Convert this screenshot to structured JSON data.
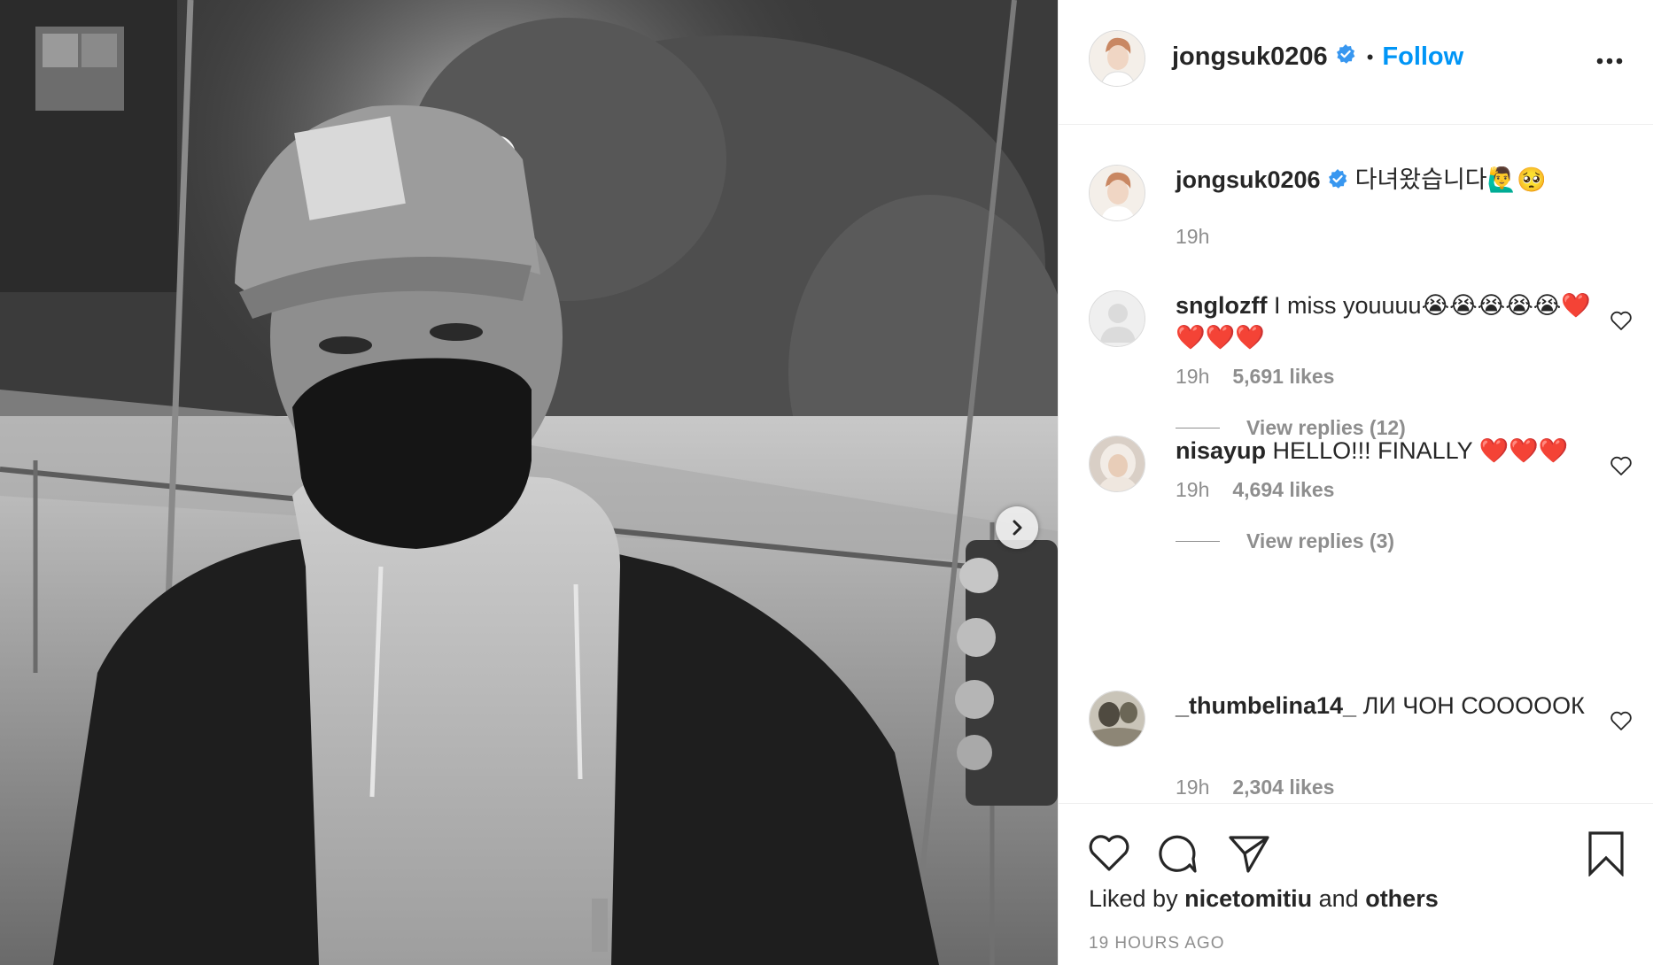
{
  "post": {
    "username": "jongsuk0206",
    "dot": "•",
    "follow_label": "Follow",
    "more_icon": "more-horizontal-icon"
  },
  "caption": {
    "username": "jongsuk0206",
    "text": "다녀왔습니다🙋‍♂️🥺",
    "time": "19h"
  },
  "comments": [
    {
      "username": "snglozff",
      "text": "I miss youuuu😭😭😭😭😭❤️❤️❤️❤️",
      "time": "19h",
      "likes": "5,691 likes",
      "replies": "View replies (12)"
    },
    {
      "username": "nisayup",
      "text": "HELLO!!! FINALLY ❤️❤️❤️",
      "time": "19h",
      "likes": "4,694 likes",
      "replies": "View replies (3)"
    },
    {
      "username": "_thumbelina14_",
      "text": "ЛИ ЧОН СООООOК",
      "time": "19h",
      "likes": "2,304 likes"
    }
  ],
  "footer": {
    "liked_prefix": "Liked by",
    "liked_user": "nicetomitiu",
    "liked_and": "and",
    "liked_others": "others",
    "timestamp": "19 HOURS AGO"
  },
  "colors": {
    "link": "#0095f6",
    "text": "#262626",
    "muted": "#8e8e8e",
    "verified": "#3897f0",
    "divider": "#efefef"
  }
}
